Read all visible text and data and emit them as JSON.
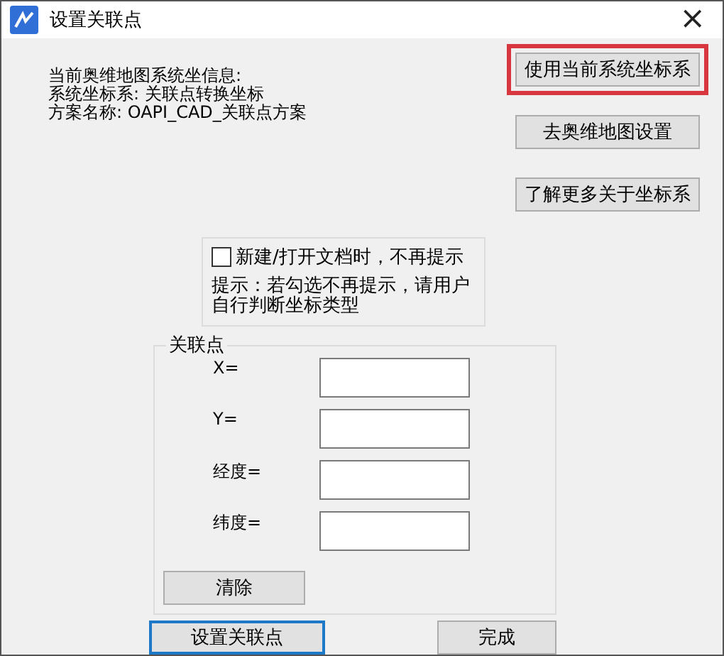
{
  "window": {
    "title": "设置关联点",
    "close": "×"
  },
  "info": [
    "当前奥维地图系统坐信息:",
    "系统坐标系: 关联点转换坐标",
    "方案名称: OAPI_CAD_关联点方案"
  ],
  "side_buttons": [
    {
      "label": "使用当前系统坐标系",
      "highlighted": true
    },
    {
      "label": "去奥维地图设置",
      "highlighted": false
    },
    {
      "label": "了解更多关于坐标系",
      "highlighted": false
    }
  ],
  "notice": {
    "checkbox": {
      "label": "新建/打开文档时，不再提示",
      "checked": false
    },
    "hint": "提示：若勾选不再提示，请用户自行判断坐标类型"
  },
  "group": {
    "title": "关联点",
    "fields": [
      {
        "label": "X="
      },
      {
        "label": "Y="
      },
      {
        "label": "经度="
      },
      {
        "label": "纬度="
      }
    ],
    "clear_button": "清除"
  },
  "bottom_buttons": [
    {
      "label": "设置关联点",
      "selected": true
    },
    {
      "label": "完成",
      "selected": false
    }
  ]
}
